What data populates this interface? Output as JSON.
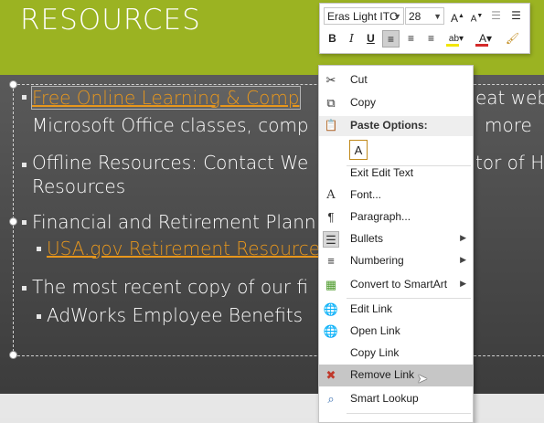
{
  "slide": {
    "title": "RESOURCES",
    "bullets": [
      {
        "text_link": "Free Online Learning & Comp",
        "text_tail": "eat web"
      },
      {
        "text": "Microsoft Office classes,  comp",
        "text_tail": "more"
      },
      {
        "text": "Offline Resources: Contact We",
        "text_tail": "tor of Hu"
      },
      {
        "text": "Resources"
      },
      {
        "text": "Financial and Retirement Plann"
      },
      {
        "text_link": "USA.gov Retirement Resource"
      },
      {
        "text": "The most recent copy of our fi"
      },
      {
        "text": "AdWorks Employee Benefits"
      }
    ]
  },
  "mini_toolbar": {
    "font_name": "Eras Light ITC",
    "font_size": "28",
    "buttons": {
      "bold": "B",
      "italic": "I",
      "underline": "U"
    }
  },
  "context_menu": {
    "items": [
      {
        "label": "Cut",
        "icon": "scissors-icon",
        "glyph": "✂"
      },
      {
        "label": "Copy",
        "icon": "copy-icon",
        "glyph": "⧉"
      },
      {
        "label": "Exit Edit Text",
        "icon": "",
        "glyph": ""
      },
      {
        "label": "Font...",
        "icon": "font-icon",
        "glyph": "A"
      },
      {
        "label": "Paragraph...",
        "icon": "paragraph-icon",
        "glyph": "¶"
      },
      {
        "label": "Bullets",
        "icon": "bullets-icon",
        "glyph": "☰"
      },
      {
        "label": "Numbering",
        "icon": "numbering-icon",
        "glyph": "≡"
      },
      {
        "label": "Convert to SmartArt",
        "icon": "smartart-icon",
        "glyph": "▦"
      },
      {
        "label": "Edit Link",
        "icon": "edit-link-icon",
        "glyph": "🔗"
      },
      {
        "label": "Open Link",
        "icon": "open-link-icon",
        "glyph": "🌐"
      },
      {
        "label": "Copy Link",
        "icon": "",
        "glyph": ""
      },
      {
        "label": "Remove Link",
        "icon": "remove-link-icon",
        "glyph": "✖"
      },
      {
        "label": "Smart Lookup",
        "icon": "smart-lookup-icon",
        "glyph": "⌕"
      }
    ],
    "paste_header": "Paste Options:",
    "paste_option_icon": "paste-keep-text-icon",
    "hovered_item": "Remove Link"
  },
  "colors": {
    "title_band": "#9bb322",
    "link": "#e8971c",
    "menu_hover": "#c6c6c6"
  }
}
